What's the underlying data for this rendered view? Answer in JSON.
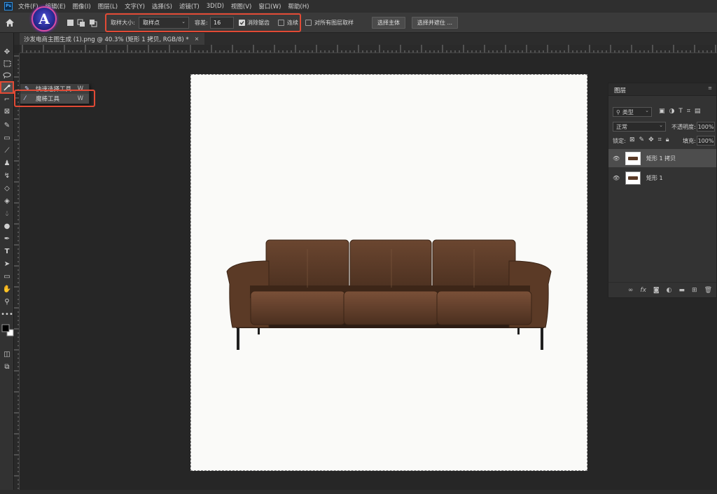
{
  "app": {
    "logo_text": "Ps"
  },
  "menu": [
    "文件(F)",
    "编辑(E)",
    "图像(I)",
    "图层(L)",
    "文字(Y)",
    "选择(S)",
    "滤镜(T)",
    "3D(D)",
    "视图(V)",
    "窗口(W)",
    "帮助(H)"
  ],
  "badge": {
    "letter": "A"
  },
  "options": {
    "sample_size_label": "取样大小:",
    "sample_size_value": "取样点",
    "tolerance_label": "容差:",
    "tolerance_value": "16",
    "antialias_label": "消除锯齿",
    "contiguous_label": "连续",
    "sample_all_label": "对所有图层取样",
    "select_subject": "选择主体",
    "select_mask": "选择并遮住 ..."
  },
  "document": {
    "tab_title": "沙发电商主图生成 (1).png @ 40.3% (矩形 1 拷贝, RGB/8) *",
    "close": "×"
  },
  "flyout": [
    {
      "label": "快速选择工具",
      "shortcut": "W"
    },
    {
      "label": "魔棒工具",
      "shortcut": "W"
    }
  ],
  "layers_panel": {
    "title": "图层",
    "filter": "类型",
    "blend_mode": "正常",
    "opacity_label": "不透明度:",
    "opacity_value": "100%",
    "lock_label": "锁定:",
    "fill_label": "填充:",
    "fill_value": "100%",
    "layers": [
      {
        "name": "矩形 1 拷贝",
        "selected": true
      },
      {
        "name": "矩形 1",
        "selected": false
      }
    ]
  },
  "colors": {
    "highlight": "#e24a35",
    "panel": "#333333",
    "sofa": "#5a3a26"
  }
}
